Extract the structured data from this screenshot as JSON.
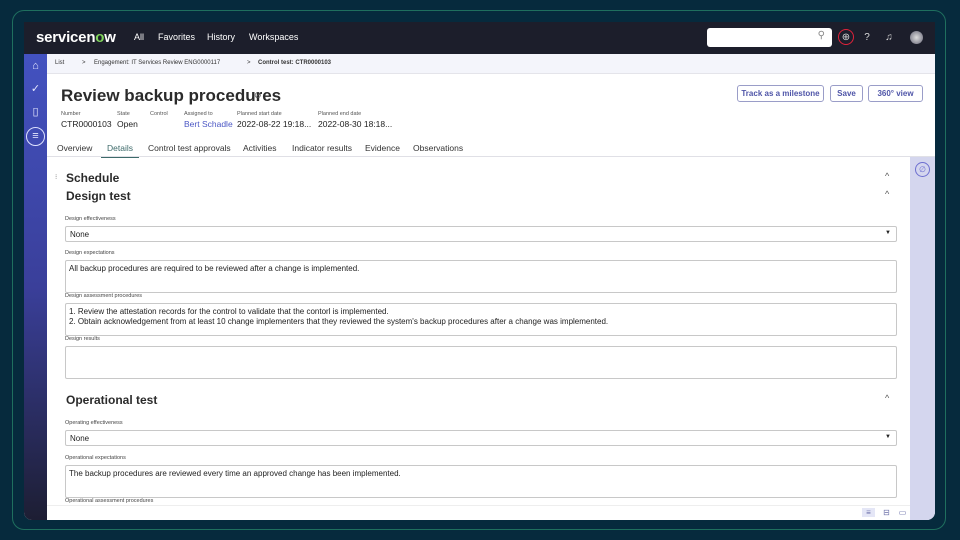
{
  "topbar": {
    "logo": "servicenow",
    "nav": [
      "All",
      "Favorites",
      "History",
      "Workspaces"
    ],
    "search_placeholder": ""
  },
  "breadcrumb": {
    "items": [
      "List",
      "Engagement: IT Services Review ENG0000117",
      "Control test: CTR0000103"
    ]
  },
  "record": {
    "title": "Review backup procedures",
    "fields": [
      {
        "label": "Number",
        "value": "CTR0000103"
      },
      {
        "label": "State",
        "value": "Open"
      },
      {
        "label": "Control",
        "value": ""
      },
      {
        "label": "Assigned to",
        "value": "Bert Schadle"
      },
      {
        "label": "Planned start date",
        "value": "2022-08-22 19:18..."
      },
      {
        "label": "Planned end date",
        "value": "2022-08-30 18:18..."
      }
    ]
  },
  "buttons": {
    "milestone": "Track as a milestone",
    "save": "Save",
    "view360": "360° view"
  },
  "tabs": [
    "Overview",
    "Details",
    "Control test approvals",
    "Activities",
    "Indicator results",
    "Evidence",
    "Observations"
  ],
  "active_tab": "Details",
  "sections": {
    "schedule": "Schedule",
    "design": "Design test",
    "operational": "Operational test"
  },
  "design": {
    "effectiveness_label": "Design effectiveness",
    "effectiveness_value": "None",
    "expectations_label": "Design expectations",
    "expectations_value": "All backup procedures are required to be reviewed after a change is implemented.",
    "assessment_label": "Design assessment procedures",
    "assessment_value": "1. Review the attestation records for the control to validate that the contorl is implemented.\n2. Obtain acknowledgement from at least 10 change implementers that they reviewed the system's backup procedures after a change was implemented.",
    "results_label": "Design results",
    "results_value": ""
  },
  "operational": {
    "effectiveness_label": "Operating effectiveness",
    "effectiveness_value": "None",
    "expectations_label": "Operational expectations",
    "expectations_value": "The backup procedures are reviewed every time an approved change has been implemented.",
    "assessment_label": "Operational assessment procedures"
  },
  "colors": {
    "topbar": "#1c1e2b",
    "accent": "#4f55a8",
    "highlight": "#e0223a"
  }
}
